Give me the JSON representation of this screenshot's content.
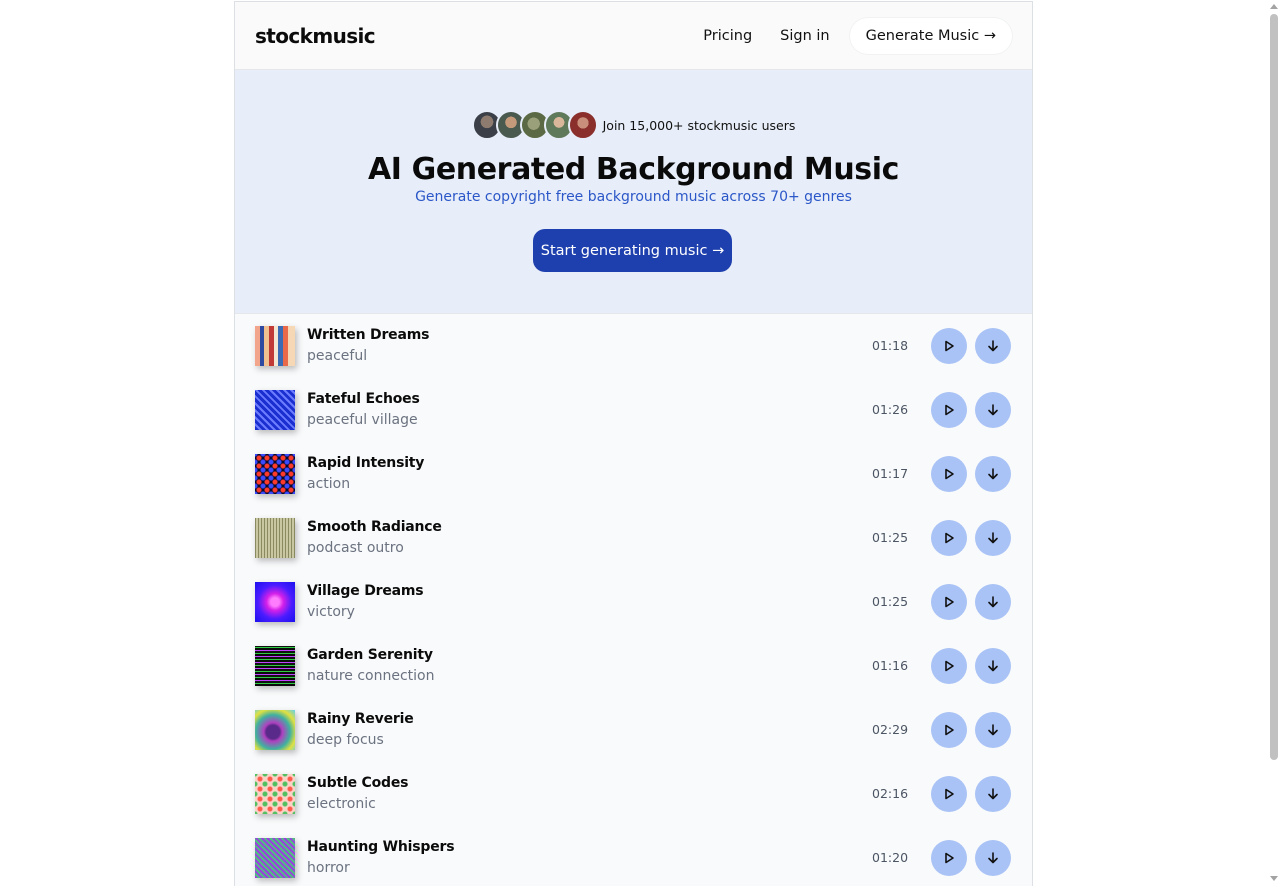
{
  "nav": {
    "logo": "stockmusic",
    "pricing": "Pricing",
    "signin": "Sign in",
    "cta": "Generate Music →"
  },
  "hero": {
    "users_text": "Join 15,000+ stockmusic users",
    "title": "AI Generated Background Music",
    "subtitle": "Generate copyright free background music across 70+ genres",
    "button": "Start generating music →"
  },
  "colors": {
    "accent": "#1e3fae",
    "subtitle": "#2b57c8",
    "hero_bg": "#e8eef9",
    "button_circle": "#a9c3f6"
  },
  "tracks": [
    {
      "title": "Written Dreams",
      "genre": "peaceful",
      "duration": "01:18"
    },
    {
      "title": "Fateful Echoes",
      "genre": "peaceful village",
      "duration": "01:26"
    },
    {
      "title": "Rapid Intensity",
      "genre": "action",
      "duration": "01:17"
    },
    {
      "title": "Smooth Radiance",
      "genre": "podcast outro",
      "duration": "01:25"
    },
    {
      "title": "Village Dreams",
      "genre": "victory",
      "duration": "01:25"
    },
    {
      "title": "Garden Serenity",
      "genre": "nature connection",
      "duration": "01:16"
    },
    {
      "title": "Rainy Reverie",
      "genre": "deep focus",
      "duration": "02:29"
    },
    {
      "title": "Subtle Codes",
      "genre": "electronic",
      "duration": "02:16"
    },
    {
      "title": "Haunting Whispers",
      "genre": "horror",
      "duration": "01:20"
    }
  ],
  "icons": {
    "play": "play-icon",
    "download": "download-arrow-icon"
  }
}
